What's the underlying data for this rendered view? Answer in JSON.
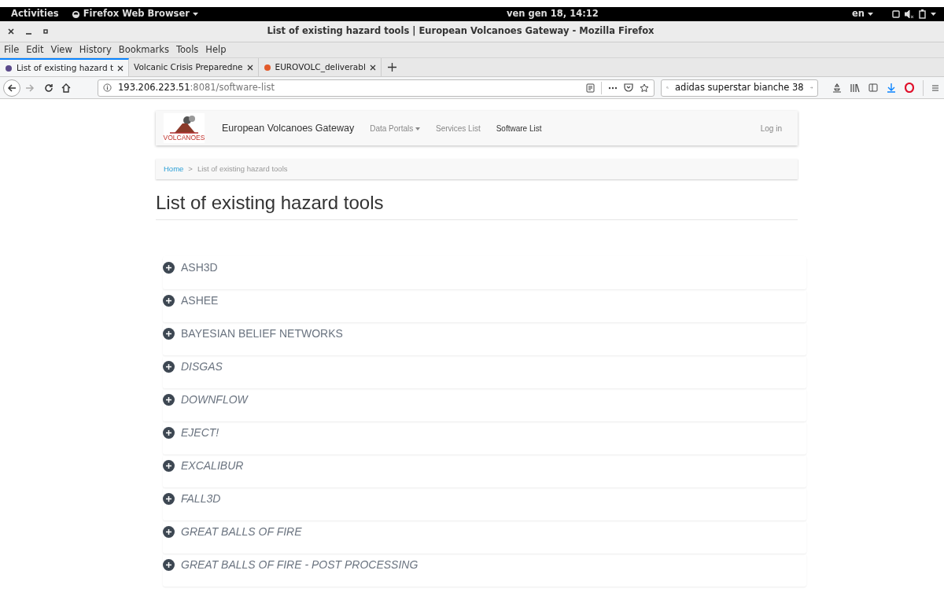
{
  "topbar": {
    "activities": "Activities",
    "app_menu": "Firefox Web Browser",
    "clock": "ven gen 18, 14:12",
    "language": "en"
  },
  "window": {
    "title": "List of existing hazard tools | European Volcanoes Gateway - Mozilla Firefox"
  },
  "menu": [
    "File",
    "Edit",
    "View",
    "History",
    "Bookmarks",
    "Tools",
    "Help"
  ],
  "tabs": [
    {
      "label": "List of existing hazard t",
      "selected": true
    },
    {
      "label": "Volcanic Crisis Preparedne",
      "selected": false
    },
    {
      "label": "EUROVOLC_deliverabl",
      "selected": false
    }
  ],
  "address": {
    "host": "193.206.223.51",
    "path": ":8081/software-list"
  },
  "search": {
    "value": "adidas superstar bianche 38"
  },
  "site": {
    "logo_text": "VOLCANOES",
    "brand": "European Volcanoes Gateway",
    "nav": [
      {
        "label": "Data Portals",
        "dropdown": true,
        "selected": false
      },
      {
        "label": "Services List",
        "dropdown": false,
        "selected": false
      },
      {
        "label": "Software List",
        "dropdown": false,
        "selected": true
      }
    ],
    "login": "Log in"
  },
  "breadcrumb": {
    "separator": ">",
    "items": [
      {
        "label": "Home",
        "kind": "link"
      },
      {
        "label": "List of existing hazard tools",
        "kind": "current"
      }
    ]
  },
  "heading": "List of existing hazard tools",
  "tools": [
    {
      "name": "ASH3D",
      "kind": "regular"
    },
    {
      "name": "ASHEE",
      "kind": "regular"
    },
    {
      "name": "BAYESIAN BELIEF NETWORKS",
      "kind": "regular"
    },
    {
      "name": "DISGAS",
      "kind": "italic"
    },
    {
      "name": "DOWNFLOW",
      "kind": "italic"
    },
    {
      "name": "EJECT!",
      "kind": "italic"
    },
    {
      "name": "EXCALIBUR",
      "kind": "italic"
    },
    {
      "name": "FALL3D",
      "kind": "italic"
    },
    {
      "name": "GREAT BALLS OF FIRE",
      "kind": "italic"
    },
    {
      "name": "GREAT BALLS OF FIRE - POST PROCESSING",
      "kind": "italic"
    }
  ]
}
